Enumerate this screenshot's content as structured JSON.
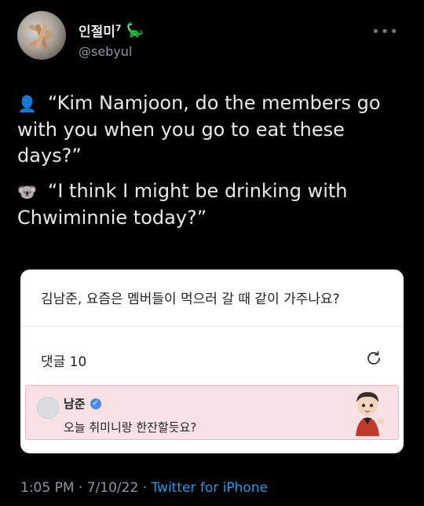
{
  "author": {
    "display_name": "인절미",
    "badge": "7",
    "handle": "@sebyul"
  },
  "tweet": {
    "line1_emoji": "👤",
    "line1": "“Kim Namjoon, do the members go with you when you go to eat these days?”",
    "line2_emoji": "🐨",
    "line2": "“I think I might be drinking with Chwiminnie today?”"
  },
  "card": {
    "title": "김남준, 요즘은 멤버들이 먹으러 갈 때 같이 가주나요?",
    "comments_label": "댓글 10",
    "comment": {
      "name": "남준",
      "text": "오늘 취미니랑 한잔할듯요?"
    }
  },
  "footer": {
    "time": "1:05 PM",
    "sep1": " · ",
    "date": "7/10/22",
    "sep2": " · ",
    "source": "Twitter for iPhone"
  }
}
